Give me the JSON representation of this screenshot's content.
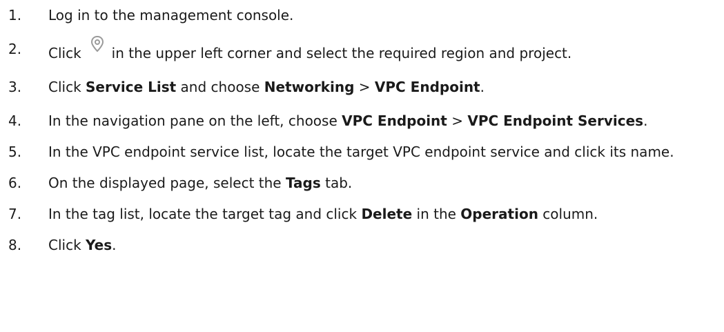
{
  "steps": [
    {
      "number": "1.",
      "parts": [
        {
          "t": "Log in to the management console.",
          "bold": false
        }
      ]
    },
    {
      "number": "2.",
      "before_icon": "Click",
      "icon": "location-pin-icon",
      "after_icon": "in the upper left corner and select the required region and project."
    },
    {
      "number": "3.",
      "parts": [
        {
          "t": "Click ",
          "bold": false
        },
        {
          "t": "Service List",
          "bold": true
        },
        {
          "t": " and choose ",
          "bold": false
        },
        {
          "t": "Networking",
          "bold": true
        },
        {
          "t": " > ",
          "bold": false
        },
        {
          "t": "VPC Endpoint",
          "bold": true
        },
        {
          "t": ".",
          "bold": false
        }
      ]
    },
    {
      "number": "4.",
      "parts": [
        {
          "t": "In the navigation pane on the left, choose ",
          "bold": false
        },
        {
          "t": "VPC Endpoint",
          "bold": true
        },
        {
          "t": " > ",
          "bold": false
        },
        {
          "t": "VPC Endpoint Services",
          "bold": true
        },
        {
          "t": ".",
          "bold": false
        }
      ]
    },
    {
      "number": "5.",
      "parts": [
        {
          "t": "In the VPC endpoint service list, locate the target VPC endpoint service and click its name.",
          "bold": false
        }
      ]
    },
    {
      "number": "6.",
      "parts": [
        {
          "t": "On the displayed page, select the ",
          "bold": false
        },
        {
          "t": "Tags",
          "bold": true
        },
        {
          "t": " tab.",
          "bold": false
        }
      ]
    },
    {
      "number": "7.",
      "parts": [
        {
          "t": "In the tag list, locate the target tag and click ",
          "bold": false
        },
        {
          "t": "Delete",
          "bold": true
        },
        {
          "t": " in the ",
          "bold": false
        },
        {
          "t": "Operation",
          "bold": true
        },
        {
          "t": " column.",
          "bold": false
        }
      ]
    },
    {
      "number": "8.",
      "parts": [
        {
          "t": "Click ",
          "bold": false
        },
        {
          "t": "Yes",
          "bold": true
        },
        {
          "t": ".",
          "bold": false
        }
      ]
    }
  ],
  "colors": {
    "text": "#1a1a1a",
    "icon": "#9a9a9a"
  }
}
